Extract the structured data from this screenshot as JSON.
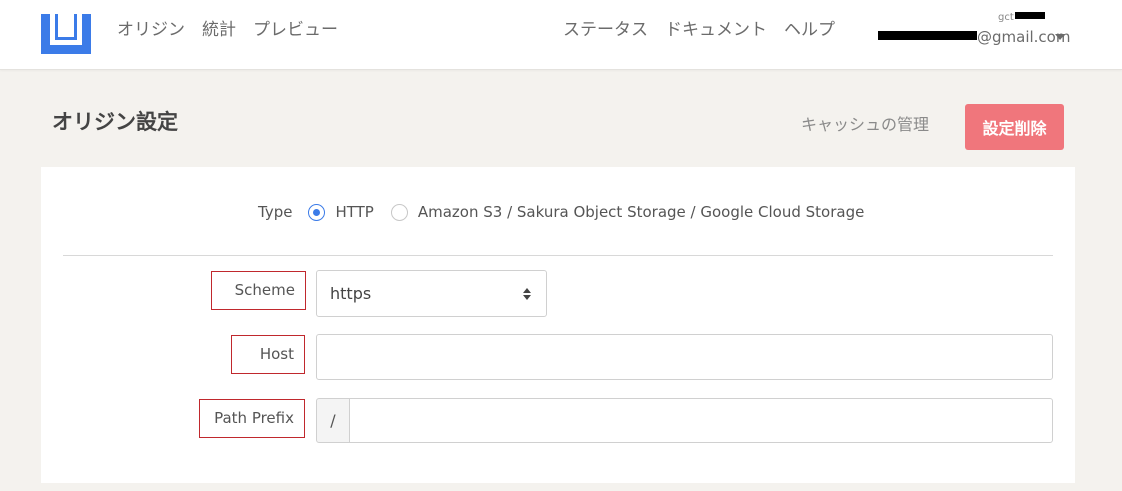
{
  "header": {
    "logo_icon": "bracket-logo-icon",
    "nav_left": [
      "オリジン",
      "統計",
      "プレビュー"
    ],
    "nav_right": [
      "ステータス",
      "ドキュメント",
      "ヘルプ"
    ],
    "account": {
      "top_text": "gct",
      "email_suffix": "@gmail.com",
      "caret_icon": "caret-down-icon"
    }
  },
  "page": {
    "title": "オリジン設定",
    "cache_link": "キャッシュの管理",
    "delete_button": "設定削除",
    "delete_color": "#f0767c"
  },
  "form": {
    "type_label": "Type",
    "type_options": [
      {
        "label": "HTTP",
        "selected": true
      },
      {
        "label": "Amazon S3 / Sakura Object Storage / Google Cloud Storage",
        "selected": false
      }
    ],
    "scheme_label": "Scheme",
    "scheme_value": "https",
    "host_label": "Host",
    "host_value": "",
    "path_prefix_label": "Path Prefix",
    "path_prefix_addon": "/",
    "path_prefix_value": ""
  },
  "colors": {
    "accent": "#3b7be8",
    "label_outline": "#c0282d"
  }
}
